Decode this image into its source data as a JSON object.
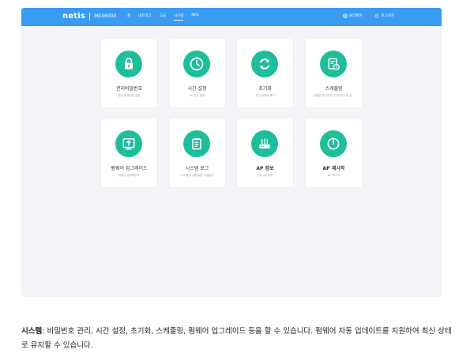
{
  "header": {
    "logo": "netis",
    "model": "MEX6000",
    "nav": [
      "홈",
      "네트워크",
      "고급",
      "시스템",
      "NAS"
    ],
    "active_index": 3,
    "right_items": [
      {
        "label": "원격제어",
        "icon": "globe-icon"
      },
      {
        "label": "로그아웃",
        "icon": "power-icon"
      }
    ]
  },
  "cards": [
    {
      "title": "관리비밀번호",
      "sub": "관리 비밀번호 설정",
      "icon": "lock-icon",
      "bold": false
    },
    {
      "title": "시간 설정",
      "sub": "AP 시간 설정",
      "icon": "clock-icon",
      "bold": false
    },
    {
      "title": "초기화",
      "sub": "공기 상태로 복구",
      "icon": "reset-icon",
      "bold": false
    },
    {
      "title": "스케줄링",
      "sub": "설정된 루거이전 기기이지도록 설...",
      "icon": "schedule-icon",
      "bold": false
    },
    {
      "title": "펌웨어 업그레이드",
      "sub": "펌웨어 업그레이드",
      "icon": "upload-icon",
      "bold": false
    },
    {
      "title": "시스템 로그",
      "sub": "시스템 로그를 통한 시점분석",
      "icon": "clipboard-icon",
      "bold": false
    },
    {
      "title": "AP 정보",
      "sub": "전지 AP 정보",
      "icon": "router-icon",
      "bold": true
    },
    {
      "title": "AP 재시작",
      "sub": "AP 재시작",
      "icon": "power-icon",
      "bold": true
    }
  ],
  "description": {
    "label": "시스템",
    "text": ": 비밀번호 관리, 시간 설정, 초기화, 스케줄링, 펌웨어 업그레이드 등을 할 수 있습니다. 펌웨어 자동 업데이트를 지원하여 최신 상태로 유지할 수 있습니다."
  },
  "colors": {
    "topbar": "#3a9bf3",
    "icon_bg": "#1fbe9a",
    "panel_bg": "#f2f4f7"
  }
}
